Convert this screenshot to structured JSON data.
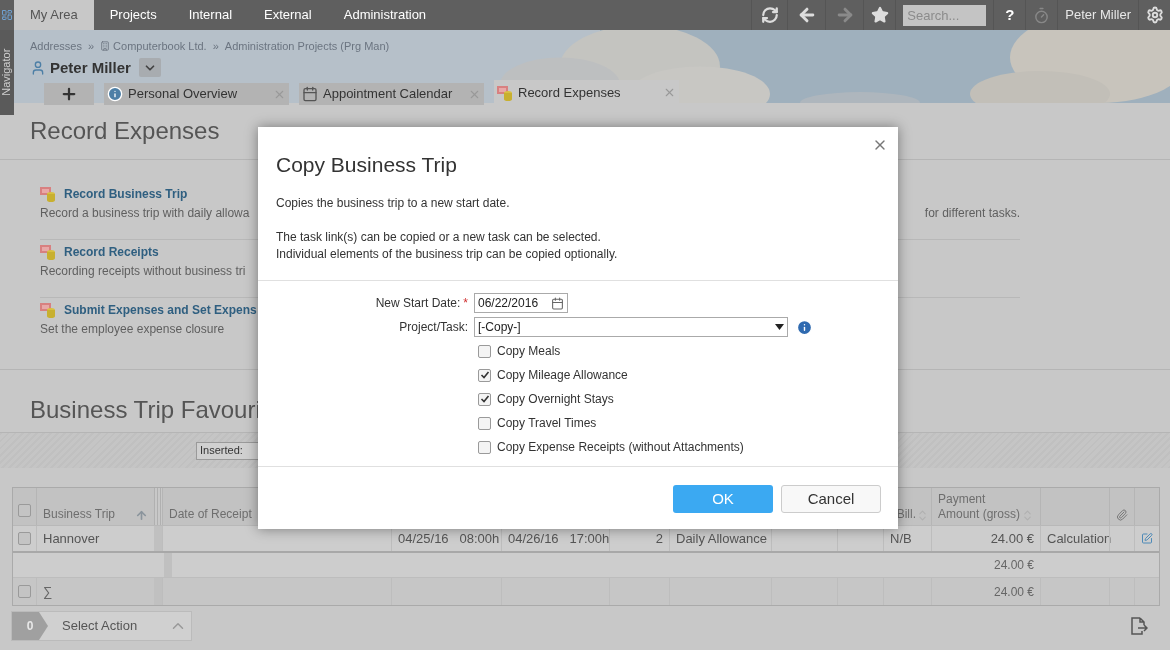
{
  "top_nav": {
    "tabs": [
      {
        "label": "My Area",
        "selected": true
      },
      {
        "label": "Projects",
        "selected": false
      },
      {
        "label": "Internal",
        "selected": false
      },
      {
        "label": "External",
        "selected": false
      },
      {
        "label": "Administration",
        "selected": false
      }
    ],
    "forward_disabled": true,
    "search": {
      "placeholder": "Search..."
    },
    "help": "?",
    "timer_disabled": true,
    "user": "Peter Miller"
  },
  "navigator": {
    "label": "Navigator"
  },
  "breadcrumb": {
    "separator": "»",
    "items": [
      {
        "label": "Addresses",
        "kind": "plain"
      },
      {
        "label": "Computerbook Ltd.",
        "kind": "company"
      },
      {
        "label": "Administration Projects (Prg Man)",
        "kind": "plain"
      }
    ]
  },
  "person": "Peter Miller",
  "tabs": [
    {
      "label": "Personal Overview",
      "kind": "info",
      "selected": false
    },
    {
      "label": "Appointment Calendar",
      "kind": "calendar",
      "selected": false
    },
    {
      "label": "Record Expenses",
      "kind": "expenses",
      "selected": true
    }
  ],
  "page_title": "Record Expenses",
  "actions": [
    {
      "title": "Record Business Trip",
      "description": "Record a business trip with daily allowa",
      "description_end": "for different tasks."
    },
    {
      "title": "Record Receipts",
      "description": "Recording receipts without business tri"
    },
    {
      "title": "Submit Expenses and Set Expens",
      "description": "Set the employee expense closure"
    }
  ],
  "favourites": {
    "title": "Business Trip Favouri",
    "filter_label": "Inserted:"
  },
  "table": {
    "header_checked": false,
    "columns": [
      {
        "label": "Business Trip",
        "sorted": true
      },
      {
        "label": "Date of Receipt"
      },
      null,
      null,
      null,
      null,
      null,
      null,
      {
        "label": "Bill.",
        "sorted": false
      },
      {
        "label": "Payment Amount (gross)",
        "sorted": false
      },
      null,
      {
        "kind": "attachment"
      },
      null
    ],
    "rows": [
      {
        "checked": false,
        "cells": [
          "Hannover",
          null,
          "04/25/16   08:00h",
          "04/26/16   17:00h",
          "2",
          "Daily Allowance",
          null,
          null,
          "N/B",
          "24.00 €",
          "Calculation",
          null,
          null
        ]
      }
    ],
    "subtotal": "24.00 €",
    "sum_row": {
      "checked": false,
      "label": "∑",
      "amount": "24.00 €"
    }
  },
  "bulk": {
    "count": "0",
    "label": "Select Action"
  },
  "dialog": {
    "title": "Copy Business Trip",
    "lines": [
      "Copies the business trip to a new start date.",
      "The task link(s) can be copied or a new task can be selected.",
      "Individual elements of the business trip can be copied optionally."
    ],
    "start_date": {
      "label": "New Start Date:",
      "required_mark": "*",
      "value": "06/22/2016"
    },
    "task": {
      "label": "Project/Task:",
      "value": "[-Copy-]"
    },
    "options": [
      {
        "label": "Copy Meals",
        "checked": false
      },
      {
        "label": "Copy Mileage Allowance",
        "checked": true
      },
      {
        "label": "Copy Overnight Stays",
        "checked": true
      },
      {
        "label": "Copy Travel Times",
        "checked": false
      },
      {
        "label": "Copy Expense Receipts (without Attachments)",
        "checked": false
      }
    ],
    "buttons": [
      {
        "label": "OK",
        "kind": "primary"
      },
      {
        "label": "Cancel",
        "kind": "secondary"
      }
    ]
  }
}
